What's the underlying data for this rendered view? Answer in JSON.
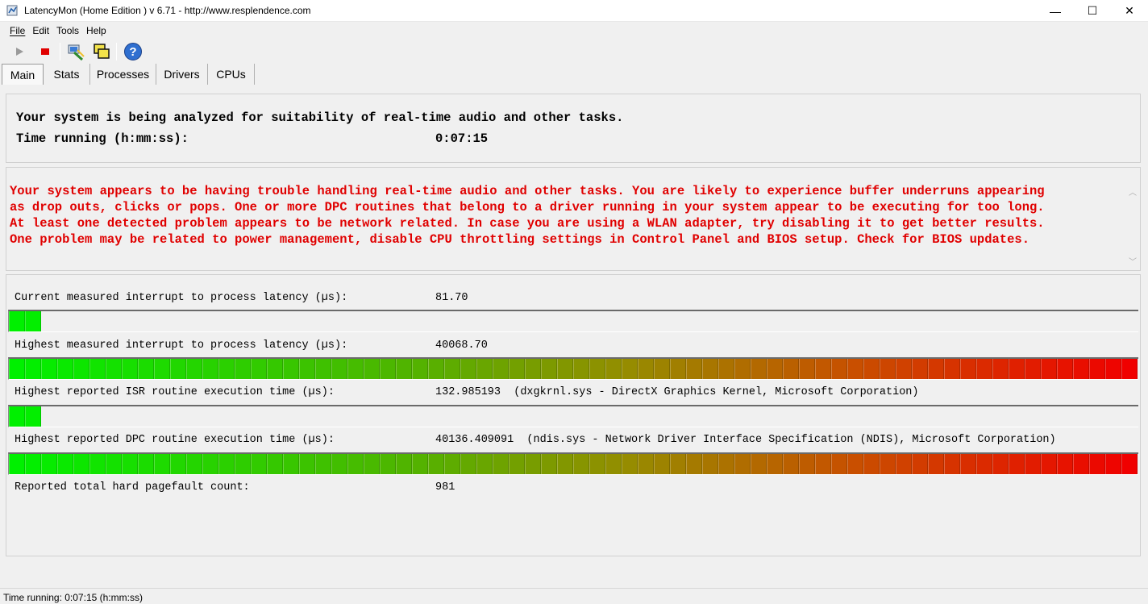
{
  "window": {
    "title": "LatencyMon  (Home Edition )  v 6.71 - http://www.resplendence.com",
    "minimize": "—",
    "maximize": "☐",
    "close": "✕"
  },
  "menu": [
    "File",
    "Edit",
    "Tools",
    "Help"
  ],
  "toolbar": {
    "icons": [
      "play-icon",
      "stop-icon",
      "hardware-icon",
      "windows-icon",
      "help-icon"
    ]
  },
  "tabs": [
    "Main",
    "Stats",
    "Processes",
    "Drivers",
    "CPUs"
  ],
  "status": {
    "line1": "Your system is being analyzed for suitability of real-time audio and other tasks.",
    "time_label": "Time running (h:mm:ss):",
    "time_value": "0:07:15"
  },
  "warning": {
    "color": "#e00000",
    "lines": [
      "Your system appears to be having trouble handling real-time audio and other tasks. You are likely to experience buffer underruns appearing",
      "as drop outs, clicks or pops. One or more DPC routines that belong to a driver running in your system appear to be executing for too long.",
      "At least one detected problem appears to be network related. In case you are using a WLAN adapter, try disabling it to get better results.",
      "One problem may be related to power management, disable CPU throttling settings in Control Panel and BIOS setup. Check for BIOS updates."
    ]
  },
  "stats": [
    {
      "label": "Current measured interrupt to process latency (µs):",
      "value": "81.70",
      "level": 0.029
    },
    {
      "label": "Highest measured interrupt to process latency (µs):",
      "value": "40068.70",
      "level": 1.0
    },
    {
      "label": "Highest reported ISR routine execution time (µs):",
      "value": "132.985193  (dxgkrnl.sys - DirectX Graphics Kernel, Microsoft Corporation)",
      "level": 0.029
    },
    {
      "label": "Highest reported DPC routine execution time (µs):",
      "value": "40136.409091  (ndis.sys - Network Driver Interface Specification (NDIS), Microsoft Corporation)",
      "level": 1.0
    }
  ],
  "pagefault": {
    "label": "Reported total hard pagefault count:",
    "value": "981"
  },
  "statusbar": {
    "text": "Time running: 0:07:15  (h:mm:ss)"
  }
}
